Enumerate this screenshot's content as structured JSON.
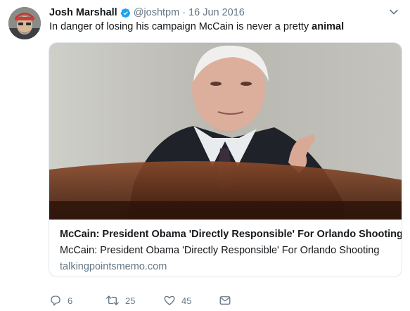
{
  "tweet": {
    "display_name": "Josh Marshall",
    "handle": "@joshtpm",
    "separator": "·",
    "date": "16 Jun 2016",
    "text_before": "In danger of losing his campaign McCain is never a pretty ",
    "text_bold": "animal"
  },
  "card": {
    "title": "McCain: President Obama 'Directly Responsible' For Orlando Shooting",
    "description": "McCain: President Obama 'Directly Responsible' For Orlando Shooting",
    "domain": "talkingpointsmemo.com"
  },
  "actions": {
    "reply_count": "6",
    "retweet_count": "25",
    "like_count": "45"
  },
  "colors": {
    "text": "#14171a",
    "secondary": "#657786",
    "verified": "#1da1f2",
    "card_border": "#e1e8ed"
  },
  "icons": [
    "verified-badge-icon",
    "caret-down-icon",
    "reply-icon",
    "retweet-icon",
    "like-icon",
    "direct-message-icon"
  ]
}
